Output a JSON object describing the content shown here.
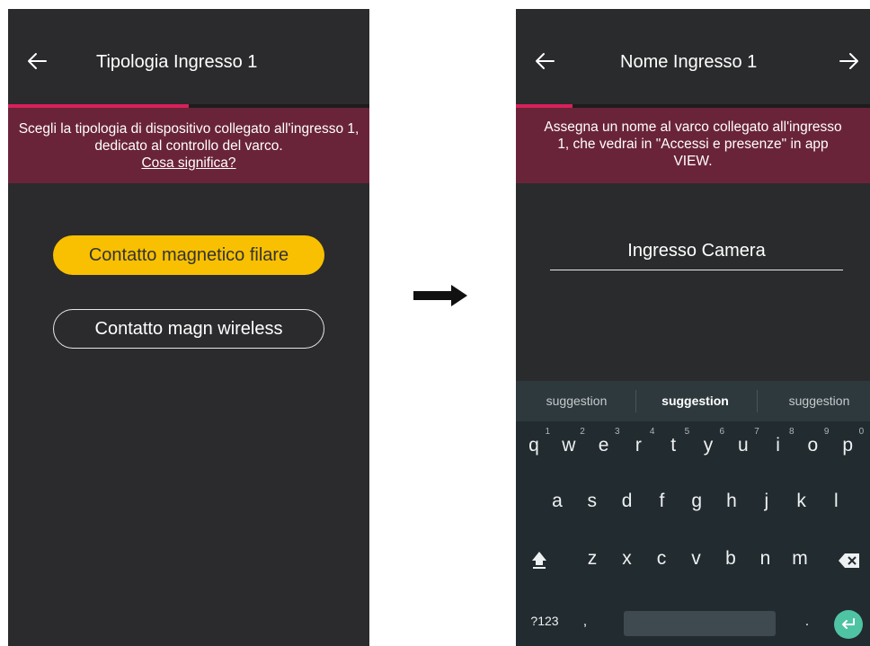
{
  "screen1": {
    "title": "Tipologia Ingresso 1",
    "back_icon": "arrow-left-icon",
    "progress": 0.5,
    "banner_text": "Scegli la tipologia di dispositivo collegato all'ingresso 1, dedicato al controllo del varco.",
    "banner_link": "Cosa significa?",
    "option_wired": "Contatto magnetico filare",
    "option_wireless": "Contatto magn wireless",
    "accent_color": "#f8c000"
  },
  "flow_arrow_icon": "arrow-right-icon",
  "screen2": {
    "title": "Nome Ingresso 1",
    "back_icon": "arrow-left-icon",
    "next_icon": "arrow-right-icon",
    "progress": 0.16,
    "banner_text": "Assegna un nome al varco collegato all'ingresso 1, che vedrai in \"Accessi e presenze\" in app VIEW.",
    "name_value": "Ingresso Camera",
    "progress_color": "#d8205a"
  },
  "keyboard": {
    "suggestions": [
      "suggestion",
      "suggestion",
      "suggestion"
    ],
    "row1": [
      "q",
      "w",
      "e",
      "r",
      "t",
      "y",
      "u",
      "i",
      "o",
      "p"
    ],
    "row1_hints": [
      "1",
      "2",
      "3",
      "4",
      "5",
      "6",
      "7",
      "8",
      "9",
      "0"
    ],
    "row2": [
      "a",
      "s",
      "d",
      "f",
      "g",
      "h",
      "j",
      "k",
      "l"
    ],
    "row3": [
      "z",
      "x",
      "c",
      "v",
      "b",
      "n",
      "m"
    ],
    "symbols_label": "?123",
    "comma": ",",
    "period": ".",
    "shift_icon": "shift-icon",
    "backspace_icon": "backspace-icon",
    "enter_icon": "enter-icon"
  }
}
